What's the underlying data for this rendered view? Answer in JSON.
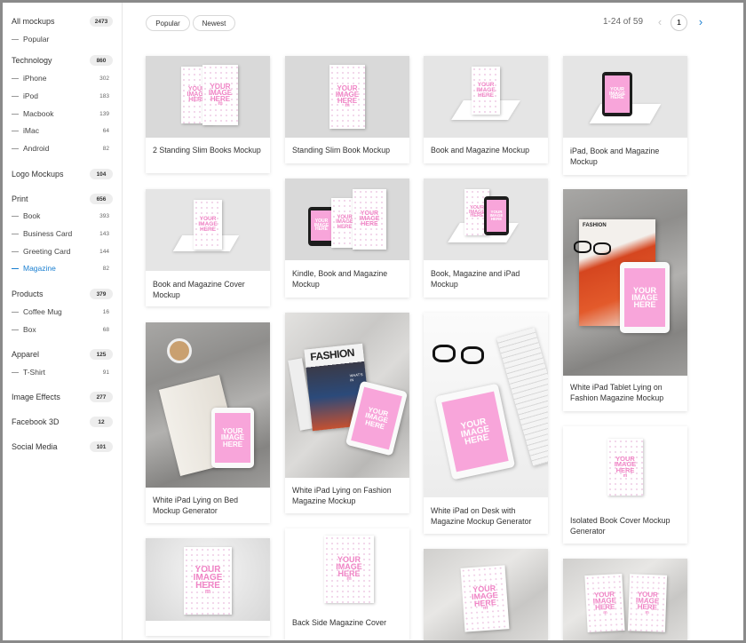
{
  "sidebar": {
    "categories": [
      {
        "label": "All mockups",
        "count": "2473"
      },
      {
        "label": "Popular"
      },
      {
        "label": "Technology",
        "count": "860"
      },
      {
        "label": "iPhone",
        "count": "302"
      },
      {
        "label": "iPod",
        "count": "183"
      },
      {
        "label": "Macbook",
        "count": "139"
      },
      {
        "label": "iMac",
        "count": "64"
      },
      {
        "label": "Android",
        "count": "82"
      },
      {
        "label": "Logo Mockups",
        "count": "104"
      },
      {
        "label": "Print",
        "count": "656"
      },
      {
        "label": "Book",
        "count": "393"
      },
      {
        "label": "Business Card",
        "count": "143"
      },
      {
        "label": "Greeting Card",
        "count": "144"
      },
      {
        "label": "Magazine",
        "count": "82",
        "active": true
      },
      {
        "label": "Products",
        "count": "379"
      },
      {
        "label": "Coffee Mug",
        "count": "16"
      },
      {
        "label": "Box",
        "count": "68"
      },
      {
        "label": "Apparel",
        "count": "125"
      },
      {
        "label": "T-Shirt",
        "count": "91"
      },
      {
        "label": "Image Effects",
        "count": "277"
      },
      {
        "label": "Facebook 3D",
        "count": "12"
      },
      {
        "label": "Social Media",
        "count": "101"
      }
    ]
  },
  "toolbar": {
    "filters": [
      "Popular",
      "Newest"
    ],
    "page_info": "1-24 of 59",
    "page_number": "1",
    "prev_icon": "chevron-left-icon",
    "next_icon": "chevron-right-icon"
  },
  "placeholder": {
    "line1": "YOUR",
    "line2": "IMAGE",
    "line3": "HERE",
    "mark": "m"
  },
  "magazine_cover": {
    "title": "FASHION",
    "title2": "FASHION",
    "title3": "FASHION",
    "tag": "WHAT'S IN"
  },
  "cards": [
    {
      "title": "2 Standing Slim Books Mockup"
    },
    {
      "title": "Standing Slim Book Mockup"
    },
    {
      "title": "Book and Magazine Mockup"
    },
    {
      "title": "iPad, Book and Magazine Mockup"
    },
    {
      "title": "Book and Magazine Cover Mockup"
    },
    {
      "title": "Kindle, Book and Magazine Mockup"
    },
    {
      "title": "Book, Magazine and iPad Mockup"
    },
    {
      "title": "White iPad Tablet Lying on Fashion Magazine Mockup"
    },
    {
      "title": "White iPad Lying on Bed Mockup Generator"
    },
    {
      "title": "White iPad Lying on Fashion Magazine Mockup"
    },
    {
      "title": "White iPad on Desk with Magazine Mockup Generator"
    },
    {
      "title": "Isolated Book Cover Mockup Generator"
    },
    {
      "title": ""
    },
    {
      "title": "Back Side Magazine Cover"
    },
    {
      "title": ""
    },
    {
      "title": ""
    }
  ],
  "colors": {
    "accent": "#1a7fd1",
    "placeholder_pink": "#f8a5da"
  }
}
